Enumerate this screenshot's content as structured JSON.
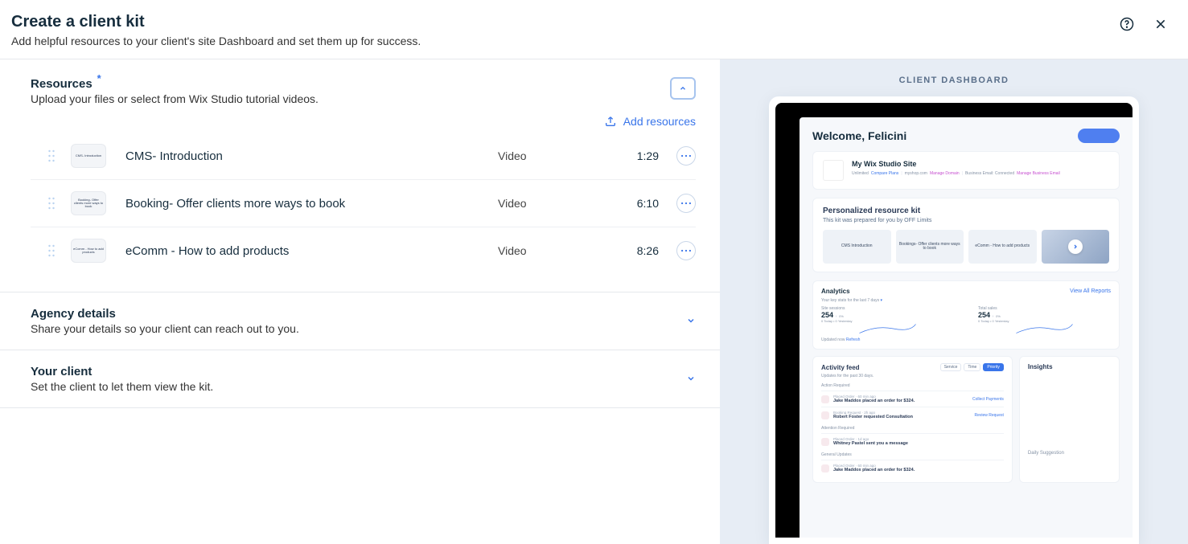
{
  "header": {
    "title": "Create a client kit",
    "subtitle": "Add helpful resources to your client's site Dashboard and set them up for success."
  },
  "sections": {
    "resources": {
      "title": "Resources",
      "required": "*",
      "desc": "Upload your files or select from Wix Studio tutorial videos.",
      "add_label": "Add resources",
      "items": [
        {
          "thumb": "CMS- Introduction",
          "title": "CMS- Introduction",
          "type": "Video",
          "duration": "1:29"
        },
        {
          "thumb": "Booking- Offer clients more ways to book",
          "title": "Booking- Offer clients more ways to book",
          "type": "Video",
          "duration": "6:10"
        },
        {
          "thumb": "eComm - How to add products",
          "title": "eComm - How to add products",
          "type": "Video",
          "duration": "8:26"
        }
      ]
    },
    "agency": {
      "title": "Agency details",
      "desc": "Share your details so your client can reach out to you."
    },
    "client": {
      "title": "Your client",
      "desc": "Set the client to let them view the kit."
    }
  },
  "preview": {
    "label": "CLIENT DASHBOARD",
    "welcome": "Welcome, Felicini",
    "site": {
      "name": "My Wix Studio Site",
      "meta": {
        "plan": "Unlimited",
        "compare": "Compare Plans",
        "domain": "myshop.com",
        "manage_domain": "Manage Domain",
        "email_label": "Business Email: Connected",
        "manage_email": "Manage Business Email"
      }
    },
    "kit": {
      "title": "Personalized resource kit",
      "sub": "This kit was prepared for you by OFF Limits",
      "thumbs": [
        "CMS Introduction",
        "Bookings- Offer clients more ways to book",
        "eComm - How to add products"
      ]
    },
    "analytics": {
      "title": "Analytics",
      "view_all": "View All Reports",
      "range": "Your key stats for the last 7 days",
      "stats": [
        {
          "label": "Site sessions",
          "value": "254",
          "delta": "0%",
          "sub": "0 Today • 0 Yesterday"
        },
        {
          "label": "Total sales",
          "value": "254",
          "delta": "0%",
          "sub": "0 Today • 0 Yesterday"
        }
      ],
      "updated": "Updated now",
      "refresh": "Refresh"
    },
    "activity": {
      "title": "Activity feed",
      "sub": "Updates for the past 30 days.",
      "filters": [
        "Service",
        "Time",
        "Priority"
      ],
      "groups": [
        {
          "label": "Action Required",
          "items": [
            {
              "meta": "Placed Order  ·  60 min ago",
              "msg": "Jake Maddox placed an order for $324.",
              "action": "Collect Payments"
            },
            {
              "meta": "Booking Request  ·  2h ago",
              "msg": "Robert Foster requested Consultation",
              "action": "Review Request"
            }
          ]
        },
        {
          "label": "Attention Required",
          "items": [
            {
              "meta": "Placed Order  ·  1d ago",
              "msg": "Whitney Pastel sent you a message",
              "action": ""
            }
          ]
        },
        {
          "label": "General Updates",
          "items": [
            {
              "meta": "Placed Order  ·  60 min ago",
              "msg": "Jake Maddox placed an order for $324.",
              "action": ""
            }
          ]
        }
      ]
    },
    "insights": {
      "title": "Insights",
      "suggestion": "Daily Suggestion"
    }
  }
}
